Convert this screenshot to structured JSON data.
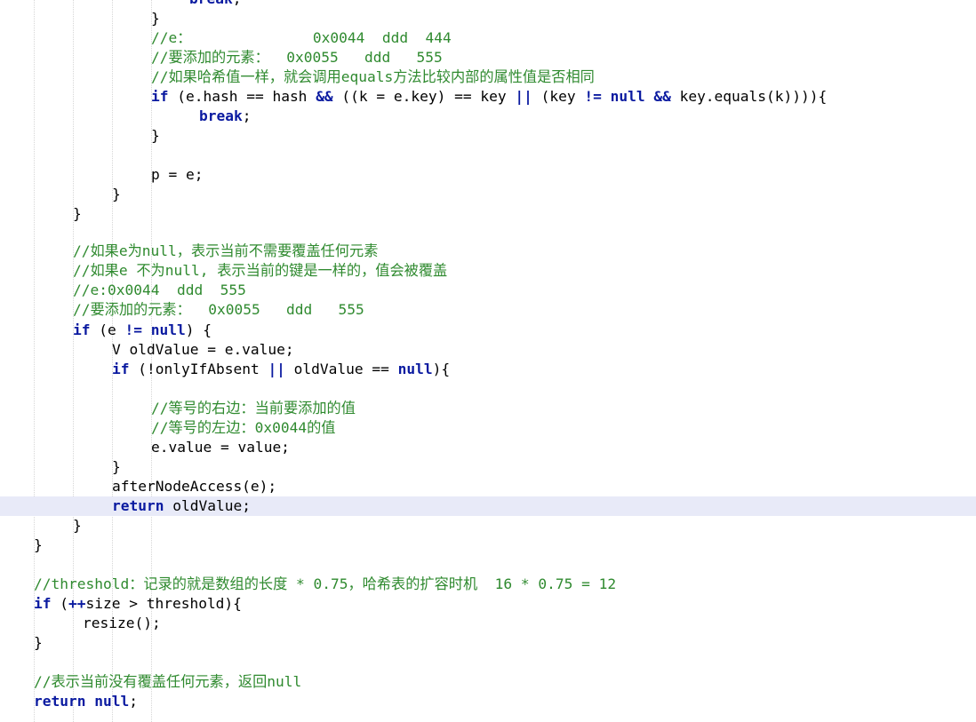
{
  "colors": {
    "keyword": "#0a1aa0",
    "comment": "#2f8a2f",
    "text": "#000000",
    "current_line": "#e8eaf8",
    "background": "#ffffff"
  },
  "code": {
    "l00": {
      "kw1": "break",
      "t1": ";"
    },
    "l01": {
      "t1": "}"
    },
    "l02": {
      "c1": "//e：              0x0044  ddd  444"
    },
    "l03": {
      "c1": "//要添加的元素：  0x0055   ddd   555"
    },
    "l04": {
      "c1": "//如果哈希值一样，就会调用equals方法比较内部的属性值是否相同"
    },
    "l05": {
      "kw1": "if",
      "t1": " (e.hash == hash ",
      "kw2": "&&",
      "t2": " ((k = e.key) == key ",
      "kw3": "||",
      "t3": " (key ",
      "kw4": "!=",
      "t4": " ",
      "kw5": "null",
      "t5": " ",
      "kw6": "&&",
      "t6": " key.equals(k)))){"
    },
    "l06": {
      "kw1": "break",
      "t1": ";"
    },
    "l07": {
      "t1": "}"
    },
    "l09": {
      "t1": "p = e;"
    },
    "l10": {
      "t1": "}"
    },
    "l11": {
      "t1": "}"
    },
    "l13": {
      "c1": "//如果e为null，表示当前不需要覆盖任何元素"
    },
    "l14": {
      "c1": "//如果e 不为null, 表示当前的键是一样的，值会被覆盖"
    },
    "l15": {
      "c1": "//e:0x0044  ddd  555"
    },
    "l16": {
      "c1": "//要添加的元素：  0x0055   ddd   555"
    },
    "l17": {
      "kw1": "if",
      "t1": " (e ",
      "kw2": "!=",
      "t2": " ",
      "kw3": "null",
      "t3": ") {"
    },
    "l18": {
      "t1": "V oldValue = e.value;"
    },
    "l19": {
      "kw1": "if",
      "t1": " (!onlyIfAbsent ",
      "kw2": "||",
      "t2": " oldValue == ",
      "kw3": "null",
      "t3": "){"
    },
    "l21": {
      "c1": "//等号的右边：当前要添加的值"
    },
    "l22": {
      "c1": "//等号的左边：0x0044的值"
    },
    "l23": {
      "t1": "e.value = value;"
    },
    "l24": {
      "t1": "}"
    },
    "l25": {
      "t1": "afterNodeAccess(e);"
    },
    "l26": {
      "kw1": "return",
      "t1": " oldValue;"
    },
    "l27": {
      "t1": "}"
    },
    "l28": {
      "t1": "}"
    },
    "l30": {
      "c1": "//threshold：记录的就是数组的长度 * 0.75，哈希表的扩容时机  16 * 0.75 = 12"
    },
    "l31": {
      "kw1": "if",
      "t1": " (",
      "kw2": "++",
      "t2": "size > threshold){"
    },
    "l32": {
      "t1": "resize();"
    },
    "l33": {
      "t1": "}"
    },
    "l35": {
      "c1": "//表示当前没有覆盖任何元素，返回null"
    },
    "l36": {
      "kw1": "return",
      "t1": " ",
      "kw2": "null",
      "t2": ";"
    }
  }
}
